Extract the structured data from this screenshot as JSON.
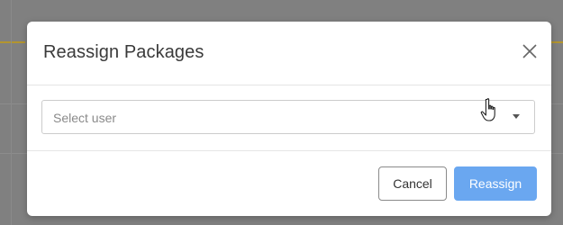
{
  "modal": {
    "title": "Reassign Packages",
    "close_icon": "close-icon"
  },
  "user_select": {
    "placeholder": "Select user",
    "caret_icon": "caret-down-icon"
  },
  "footer": {
    "cancel_label": "Cancel",
    "reassign_label": "Reassign"
  },
  "cursor": {
    "icon": "hand-pointer-icon"
  },
  "colors": {
    "primary": "#6aa7f0",
    "backdrop": "#808080",
    "accent": "#b3952f"
  }
}
